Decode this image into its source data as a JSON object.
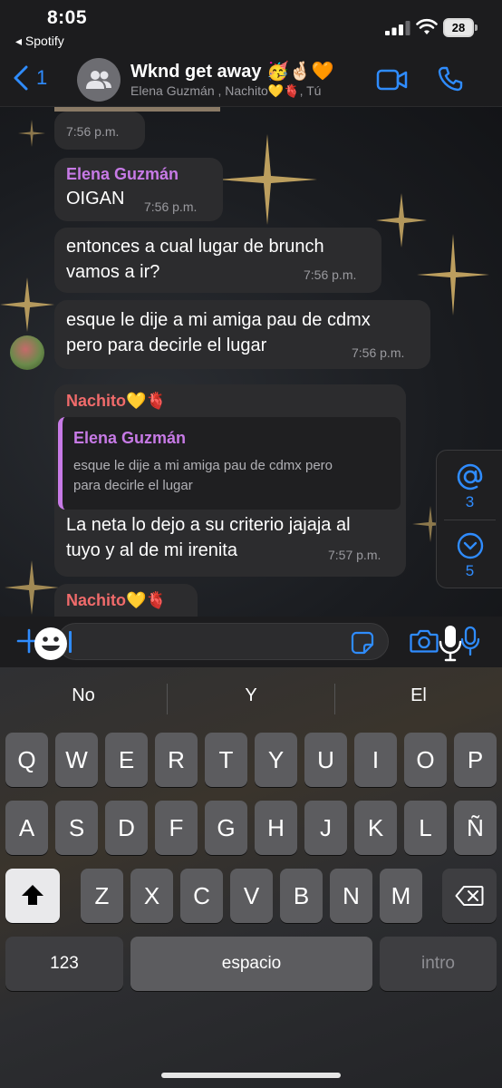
{
  "status_bar": {
    "time": "8:05",
    "back_app": "◂ Spotify",
    "battery": "28"
  },
  "header": {
    "back_count": "1",
    "title": "Wknd get away 🥳🤞🏻🧡",
    "members": "Elena Guzmán , Nachito💛🫀, Tú"
  },
  "messages": [
    {
      "time": "7:56 p.m."
    },
    {
      "sender": "Elena Guzmán",
      "text": "OIGAN",
      "time": "7:56 p.m."
    },
    {
      "text_line1": "entonces a cual lugar de brunch",
      "text_line2": "vamos a ir?",
      "time": "7:56 p.m."
    },
    {
      "text_line1": "esque le dije a mi amiga pau de cdmx",
      "text_line2": "pero para decirle el lugar",
      "time": "7:56 p.m."
    },
    {
      "sender": "Nachito💛🫀",
      "quote_sender": "Elena Guzmán",
      "quote_line1": "esque le dije a mi amiga pau de cdmx pero",
      "quote_line2": "para decirle el lugar",
      "text_line1": "La neta lo dejo a su criterio jajaja al",
      "text_line2": "tuyo y al de mi irenita",
      "time": "7:57 p.m."
    },
    {
      "sender": "Nachito💛🫀"
    }
  ],
  "side_panel": {
    "mentions": "3",
    "unread": "5"
  },
  "keyboard": {
    "suggestions": [
      "No",
      "Y",
      "El"
    ],
    "row1": [
      "Q",
      "W",
      "E",
      "R",
      "T",
      "Y",
      "U",
      "I",
      "O",
      "P"
    ],
    "row2": [
      "A",
      "S",
      "D",
      "F",
      "G",
      "H",
      "J",
      "K",
      "L",
      "Ñ"
    ],
    "row3": [
      "Z",
      "X",
      "C",
      "V",
      "B",
      "N",
      "M"
    ],
    "numbers_key": "123",
    "space_key": "espacio",
    "return_key": "intro"
  },
  "colors": {
    "accent": "#2f8cff",
    "elena": "#c77ae6",
    "nachito": "#f06b6b"
  }
}
